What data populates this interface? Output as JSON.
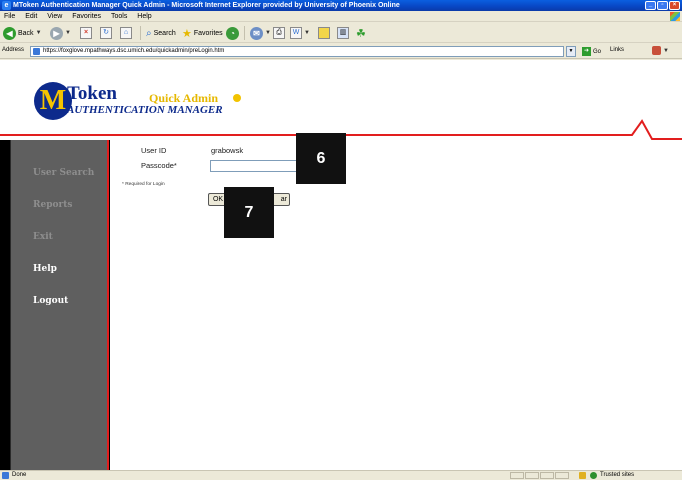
{
  "window": {
    "title": "MToken Authentication Manager Quick Admin - Microsoft Internet Explorer provided by University of Phoenix Online"
  },
  "menu": [
    "File",
    "Edit",
    "View",
    "Favorites",
    "Tools",
    "Help"
  ],
  "toolbar": {
    "back_label": "Back",
    "search_label": "Search",
    "favorites_label": "Favorites"
  },
  "address": {
    "label": "Address",
    "url": "https://foxglove.mpathways.dsc.umich.edu/quickadmin/preLogin.htm",
    "go_label": "Go",
    "links_label": "Links"
  },
  "header": {
    "logo_letter": "M",
    "brand_token": "Token",
    "brand_quick": "Quick Admin",
    "brand_sub": "AUTHENTICATION MANAGER"
  },
  "sidebar": {
    "items": [
      {
        "label": "User Search",
        "state": "disabled"
      },
      {
        "label": "Reports",
        "state": "disabled"
      },
      {
        "label": "Exit",
        "state": "disabled"
      },
      {
        "label": "Help",
        "state": "enabled"
      },
      {
        "label": "Logout",
        "state": "enabled"
      }
    ]
  },
  "form": {
    "user_id_label": "User ID",
    "user_id_value": "grabowsk",
    "passcode_label": "Passcode*",
    "passcode_value": "",
    "required_note": "* Required for Login",
    "ok_label": "OK",
    "clear_label": "ar"
  },
  "callouts": [
    "6",
    "7"
  ],
  "status": {
    "text": "Done",
    "zone": "Trusted sites"
  },
  "colors": {
    "accent_red": "#e21e1e",
    "umich_blue": "#0d2a8c",
    "umich_maize": "#f2c300",
    "sidebar_bg": "#5f5f5f"
  }
}
